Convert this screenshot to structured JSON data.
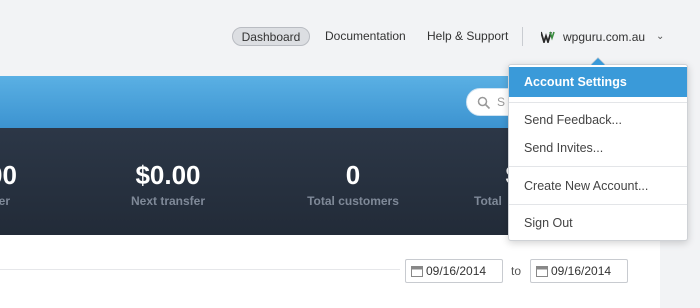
{
  "nav": {
    "dashboard": "Dashboard",
    "documentation": "Documentation",
    "help": "Help & Support",
    "account_name": "wpguru.com.au"
  },
  "search": {
    "placeholder": "S"
  },
  "stats": [
    {
      "value": "00",
      "label": "sfer"
    },
    {
      "value": "$0.00",
      "label": "Next transfer"
    },
    {
      "value": "0",
      "label": "Total customers"
    },
    {
      "value": "$",
      "label": "Total"
    }
  ],
  "date_range": {
    "from": "09/16/2014",
    "to_label": "to",
    "to": "09/16/2014"
  },
  "dropdown": {
    "account_settings": "Account Settings",
    "send_feedback": "Send Feedback...",
    "send_invites": "Send Invites...",
    "create_account": "Create New Account...",
    "sign_out": "Sign Out"
  },
  "colors": {
    "accent_blue": "#3a9ad9",
    "header_blue": "#4aa3dc",
    "stats_dark": "#263040"
  }
}
